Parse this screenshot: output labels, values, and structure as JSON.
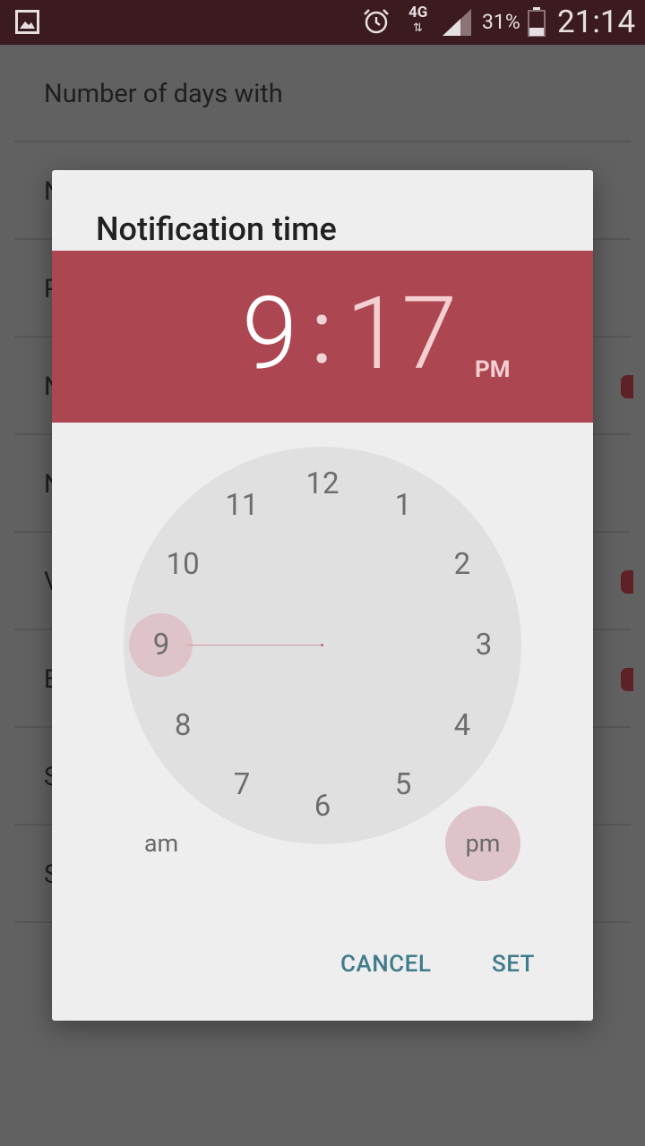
{
  "status_bar": {
    "left_icon": "image-icon",
    "alarm_icon": "alarm-clock-icon",
    "network": "4G",
    "signal_icon": "signal-bars-icon",
    "battery_percent": "31%",
    "battery_level": 0.31,
    "time": "21:14"
  },
  "background_list": {
    "first_row_label": "Number of days with",
    "row_initials": [
      "N",
      "P",
      "N",
      "N",
      "V",
      "E",
      "S",
      "S"
    ]
  },
  "dialog": {
    "title": "Notification time",
    "selected_hour": "9",
    "separator": ":",
    "selected_minute": "17",
    "period": "PM",
    "clock_numbers": [
      "12",
      "1",
      "2",
      "3",
      "4",
      "5",
      "6",
      "7",
      "8",
      "9",
      "10",
      "11"
    ],
    "am_label": "am",
    "pm_label": "pm",
    "cancel_label": "CANCEL",
    "set_label": "SET"
  },
  "colors": {
    "header": "#ac4650",
    "accent_button": "#3f7b8c",
    "selection": "#dec4c8",
    "status_bar": "#3b1a20"
  }
}
